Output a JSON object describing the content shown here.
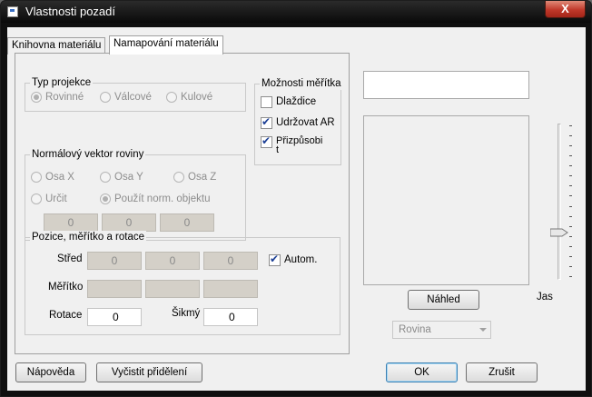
{
  "window": {
    "title": "Vlastnosti pozadí",
    "close_label": "X"
  },
  "tabs": [
    {
      "label": "Knihovna materiálu",
      "active": false
    },
    {
      "label": "Namapování materiálu",
      "active": true
    }
  ],
  "projection": {
    "title": "Typ projekce",
    "options": [
      {
        "label": "Rovinné",
        "selected": true
      },
      {
        "label": "Válcové",
        "selected": false
      },
      {
        "label": "Kulové",
        "selected": false
      }
    ]
  },
  "scale_options": {
    "title": "Možnosti měřítka",
    "items": [
      {
        "label": "Dlaždice",
        "checked": false
      },
      {
        "label": "Udržovat AR",
        "checked": true
      },
      {
        "label": "Přizpůsobi\nt",
        "checked": true
      }
    ]
  },
  "normal_vector": {
    "title": "Normálový vektor roviny",
    "axis_x": "Osa X",
    "axis_y": "Osa Y",
    "axis_z": "Osa Z",
    "custom": "Určit",
    "use_object": "Použít norm. objektu",
    "values": [
      "0",
      "0",
      "0"
    ]
  },
  "position": {
    "title": "Pozice, měřítko a rotace",
    "center_label": "Střed",
    "center_values": [
      "0",
      "0",
      "0"
    ],
    "auto_label": "Autom.",
    "auto_checked": true,
    "scale_label": "Měřítko",
    "scale_values": [
      "",
      "",
      ""
    ],
    "rotation_label": "Rotace",
    "rotation_value": "0",
    "skew_label": "Šikmý",
    "skew_value": "0"
  },
  "preview": {
    "button_label": "Náhled",
    "brightness_label": "Jas",
    "brightness_level": 0.29,
    "shape_value": "Rovina"
  },
  "buttons": {
    "help": "Nápověda",
    "clear": "Vyčistit přidělení",
    "ok": "OK",
    "cancel": "Zrušit"
  }
}
